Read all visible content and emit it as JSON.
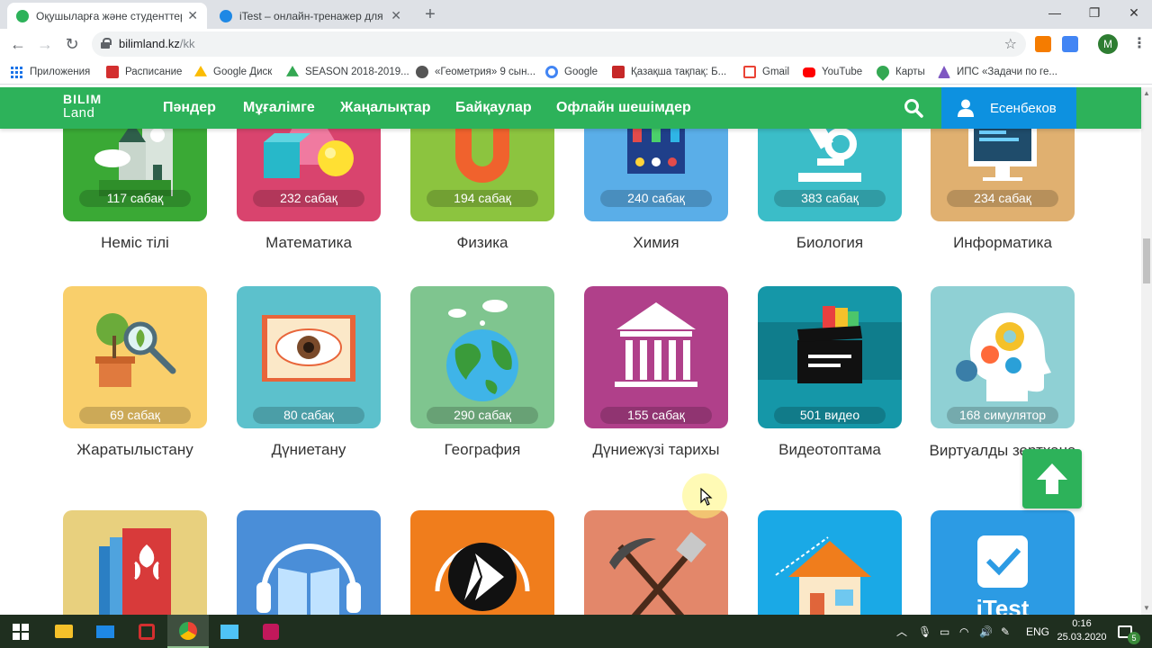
{
  "browser": {
    "tabs": [
      {
        "title": "Оқушыларға және студенттерге",
        "active": true,
        "favicon_color": "#2db25a"
      },
      {
        "title": "iTest – онлайн-тренажер для по",
        "active": false,
        "favicon_color": "#1e88e5"
      }
    ],
    "url_host": "bilimland.kz",
    "url_path": "/kk",
    "profile_initial": "M",
    "bookmarks": [
      {
        "label": "Приложения",
        "icon": "apps-icon"
      },
      {
        "label": "Расписание",
        "icon": "h-logo-icon",
        "color": "#d32f2f"
      },
      {
        "label": "Google Диск",
        "icon": "google-drive-icon",
        "color": "#fbbc04"
      },
      {
        "label": "SEASON 2018-2019...",
        "icon": "google-drive-icon",
        "color": "#34a853"
      },
      {
        "label": "«Геометрия» 9 сын...",
        "icon": "globe-icon",
        "color": "#555555"
      },
      {
        "label": "Google",
        "icon": "google-icon",
        "color": "#4285f4"
      },
      {
        "label": "Қазақша тақпақ: Б...",
        "icon": "z-logo-icon",
        "color": "#c62828"
      },
      {
        "label": "Gmail",
        "icon": "gmail-icon",
        "color": "#ea4335"
      },
      {
        "label": "YouTube",
        "icon": "youtube-icon",
        "color": "#ff0000"
      },
      {
        "label": "Карты",
        "icon": "maps-icon",
        "color": "#34a853"
      },
      {
        "label": "ИПС «Задачи по ге...",
        "icon": "ips-icon",
        "color": "#7e57c2"
      }
    ]
  },
  "site": {
    "logo_line1": "BILIM",
    "logo_line2": "Land",
    "nav": [
      "Пәндер",
      "Мұғалімге",
      "Жаңалықтар",
      "Байқаулар",
      "Офлайн шешімдер"
    ],
    "user_name": "Есенбеков",
    "accent": "#2db25a",
    "user_box_color": "#0d91e0"
  },
  "subjects": [
    {
      "count": "117 сабақ",
      "name": "Неміс тілі",
      "color": "#3aa935",
      "icon": "german-castle-icon"
    },
    {
      "count": "232 сабақ",
      "name": "Математика",
      "color": "#d9446e",
      "icon": "geometry-shapes-icon"
    },
    {
      "count": "194 сабақ",
      "name": "Физика",
      "color": "#8cc43f",
      "icon": "magnet-icon"
    },
    {
      "count": "240 сабақ",
      "name": "Химия",
      "color": "#5aaee8",
      "icon": "test-tubes-icon"
    },
    {
      "count": "383 сабақ",
      "name": "Биология",
      "color": "#3bbdc8",
      "icon": "microscope-icon"
    },
    {
      "count": "234 сабақ",
      "name": "Информатика",
      "color": "#e0b070",
      "icon": "computer-icon"
    },
    {
      "count": "69 сабақ",
      "name": "Жаратылыстану",
      "color": "#f9cf6b",
      "icon": "plant-magnifier-icon"
    },
    {
      "count": "80 сабақ",
      "name": "Дүниетану",
      "color": "#5cc1cc",
      "icon": "book-eye-icon"
    },
    {
      "count": "290 сабақ",
      "name": "География",
      "color": "#7fc58f",
      "icon": "globe-icon"
    },
    {
      "count": "155 сабақ",
      "name": "Дүниежүзі тарихы",
      "color": "#b0408a",
      "icon": "museum-icon"
    },
    {
      "count": "501 видео",
      "name": "Видеотоптама",
      "color": "#1597a8",
      "icon": "clapperboard-icon"
    },
    {
      "count": "168 симулятор",
      "name": "Виртуалды зертхана",
      "color": "#8fd0d4",
      "icon": "head-gears-icon"
    },
    {
      "count": "",
      "name": "",
      "color": "#e8d07e",
      "icon": "books-ornament-icon"
    },
    {
      "count": "",
      "name": "",
      "color": "#4a8ed8",
      "icon": "audiobook-icon"
    },
    {
      "count": "",
      "name": "",
      "color": "#f07d1c",
      "icon": "audio-a-icon"
    },
    {
      "count": "",
      "name": "",
      "color": "#e3876a",
      "icon": "pickaxe-shovel-icon"
    },
    {
      "count": "",
      "name": "",
      "color": "#1aa9e6",
      "icon": "house-drawing-icon"
    },
    {
      "count": "",
      "name": "",
      "color": "#2c9be4",
      "icon": "itest-icon",
      "logo_text": "iTest"
    }
  ],
  "taskbar": {
    "language": "ENG",
    "time": "0:16",
    "date": "25.03.2020",
    "notifications": "5"
  }
}
